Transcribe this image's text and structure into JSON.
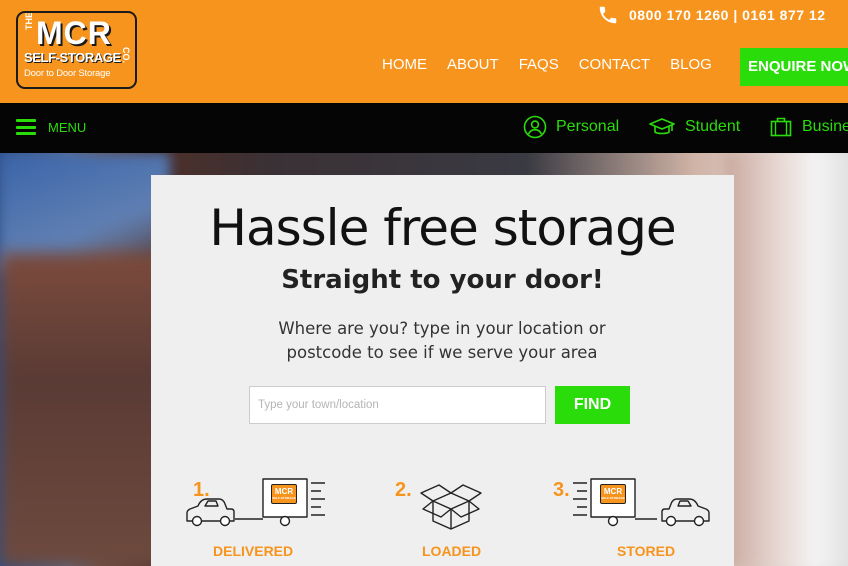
{
  "header": {
    "logo": {
      "the": "THE",
      "mcr": "MCR",
      "self_storage": "SELF-STORAGE",
      "co": "CO.",
      "tagline": "Door to Door Storage"
    },
    "phone_text": "0800 170 1260 | 0161 877 12",
    "nav": [
      "HOME",
      "ABOUT",
      "FAQS",
      "CONTACT",
      "BLOG"
    ],
    "enquire_label": "ENQUIRE NOW"
  },
  "subnav": {
    "menu_label": "MENU",
    "categories": [
      {
        "label": "Personal",
        "icon": "person-circle-icon"
      },
      {
        "label": "Student",
        "icon": "graduation-cap-icon"
      },
      {
        "label": "Business",
        "icon": "briefcase-icon"
      }
    ]
  },
  "hero": {
    "title": "Hassle free storage",
    "subtitle": "Straight to your door!",
    "description_line1": "Where are you?  type in your location or",
    "description_line2": "postcode to see if we serve your area",
    "search_placeholder": "Type your town/location",
    "search_value": "",
    "find_label": "FIND",
    "steps": [
      {
        "number": "1.",
        "label": "DELIVERED",
        "icon": "van-trailer-icon",
        "mini_logo": "MCR"
      },
      {
        "number": "2.",
        "label": "LOADED",
        "icon": "open-box-icon"
      },
      {
        "number": "3.",
        "label": "STORED",
        "icon": "trailer-van-icon",
        "mini_logo": "MCR"
      }
    ]
  },
  "colors": {
    "orange": "#f7941d",
    "green": "#2bdc0b",
    "black": "#050505",
    "card": "#efefef"
  }
}
